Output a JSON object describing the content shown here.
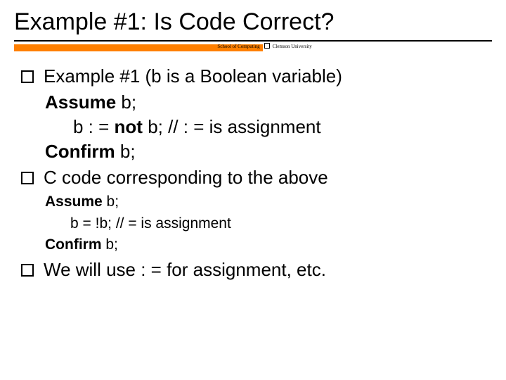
{
  "title": "Example #1: Is Code Correct?",
  "header": {
    "left_label": "School of Computing",
    "right_label": "Clemson University"
  },
  "bullets": {
    "b1": "Example #1 (b is a Boolean variable)",
    "b2": "C code corresponding to the above",
    "b3": "We will use : = for assignment, etc."
  },
  "code1": {
    "l1a": "Assume",
    "l1b": " b;",
    "l2a": "b : = ",
    "l2b": "not",
    "l2c": " b;",
    "l2_comment": "// : = is assignment",
    "l3a": "Confirm",
    "l3b": " b;"
  },
  "code2": {
    "l1a": "Assume",
    "l1b": " b;",
    "l2a": "b = !b;",
    "l2_comment": "// = is assignment",
    "l3a": "Confirm",
    "l3b": " b;"
  }
}
